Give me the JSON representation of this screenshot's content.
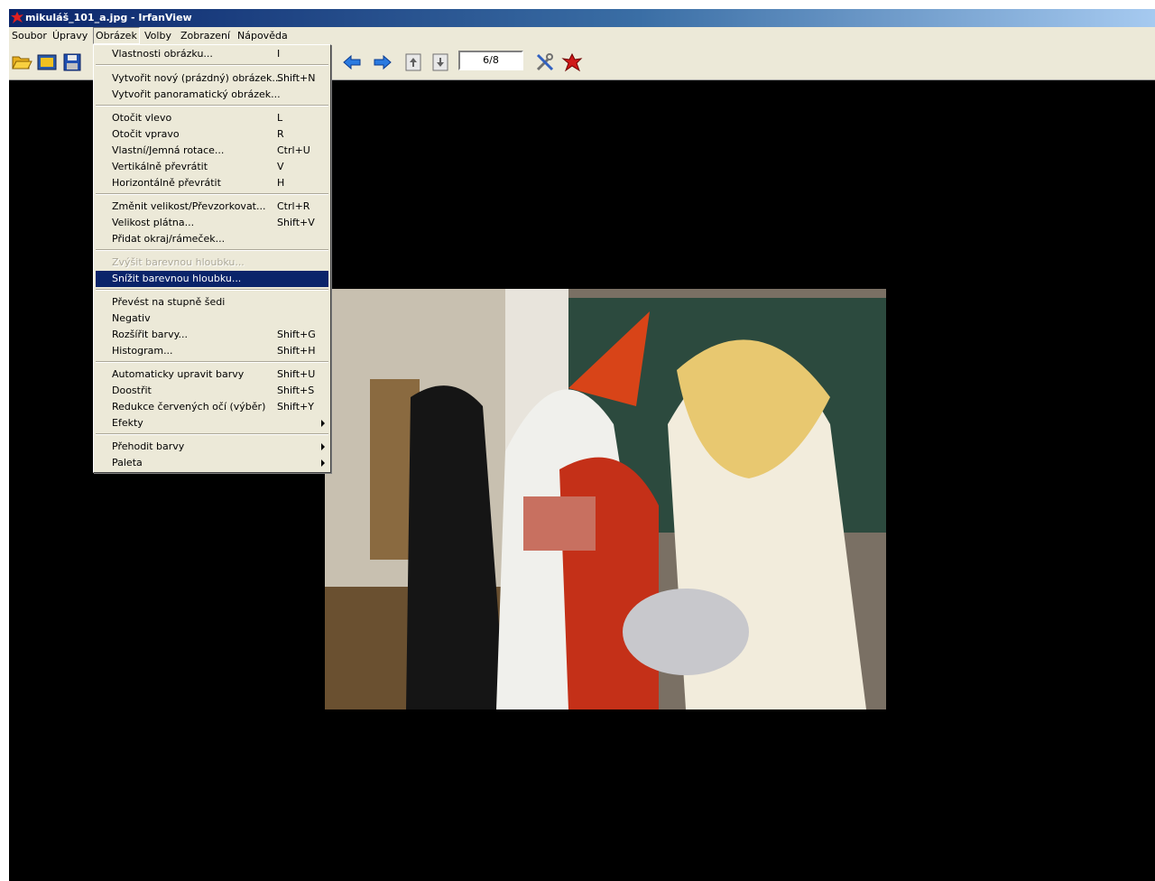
{
  "window": {
    "title": "mikuláš_101_a.jpg - IrfanView"
  },
  "menubar": [
    "Soubor",
    "Úpravy",
    "Obrázek",
    "Volby",
    "Zobrazení",
    "Nápověda"
  ],
  "toolbar": {
    "icons": [
      "open-folder-icon",
      "slideshow-icon",
      "save-icon",
      "previous-arrow-icon",
      "next-arrow-icon",
      "first-page-icon",
      "last-page-icon",
      "settings-tools-icon",
      "irfanview-logo-icon"
    ],
    "pager": "6/8"
  },
  "menu": {
    "items": [
      {
        "label": "Vlastnosti obrázku...",
        "shortcut": "I"
      },
      {
        "label": "Vytvořit nový (prázdný) obrázek...",
        "shortcut": "Shift+N"
      },
      {
        "label": "Vytvořit panoramatický obrázek...",
        "shortcut": ""
      },
      {
        "label": "Otočit vlevo",
        "shortcut": "L"
      },
      {
        "label": "Otočit vpravo",
        "shortcut": "R"
      },
      {
        "label": "Vlastní/Jemná rotace...",
        "shortcut": "Ctrl+U"
      },
      {
        "label": "Vertikálně převrátit",
        "shortcut": "V"
      },
      {
        "label": "Horizontálně převrátit",
        "shortcut": "H"
      },
      {
        "label": "Změnit velikost/Převzorkovat...",
        "shortcut": "Ctrl+R"
      },
      {
        "label": "Velikost plátna...",
        "shortcut": "Shift+V"
      },
      {
        "label": "Přidat okraj/rámeček...",
        "shortcut": ""
      },
      {
        "label": "Zvýšit barevnou hloubku...",
        "shortcut": "",
        "disabled": true
      },
      {
        "label": "Snížit barevnou hloubku...",
        "shortcut": "",
        "highlighted": true
      },
      {
        "label": "Převést na stupně šedi",
        "shortcut": ""
      },
      {
        "label": "Negativ",
        "shortcut": ""
      },
      {
        "label": "Rozšířit barvy...",
        "shortcut": "Shift+G"
      },
      {
        "label": "Histogram...",
        "shortcut": "Shift+H"
      },
      {
        "label": "Automaticky upravit barvy",
        "shortcut": "Shift+U"
      },
      {
        "label": "Doostřit",
        "shortcut": "Shift+S"
      },
      {
        "label": "Redukce červených očí (výběr)",
        "shortcut": "Shift+Y"
      },
      {
        "label": "Efekty",
        "shortcut": "",
        "submenu": true
      },
      {
        "label": "Přehodit barvy",
        "shortcut": "",
        "submenu": true
      },
      {
        "label": "Paleta",
        "shortcut": "",
        "submenu": true
      }
    ]
  },
  "colors": {
    "highlight": "#0a246a",
    "menu_bg": "#ece9d8",
    "canvas": "#000000"
  }
}
